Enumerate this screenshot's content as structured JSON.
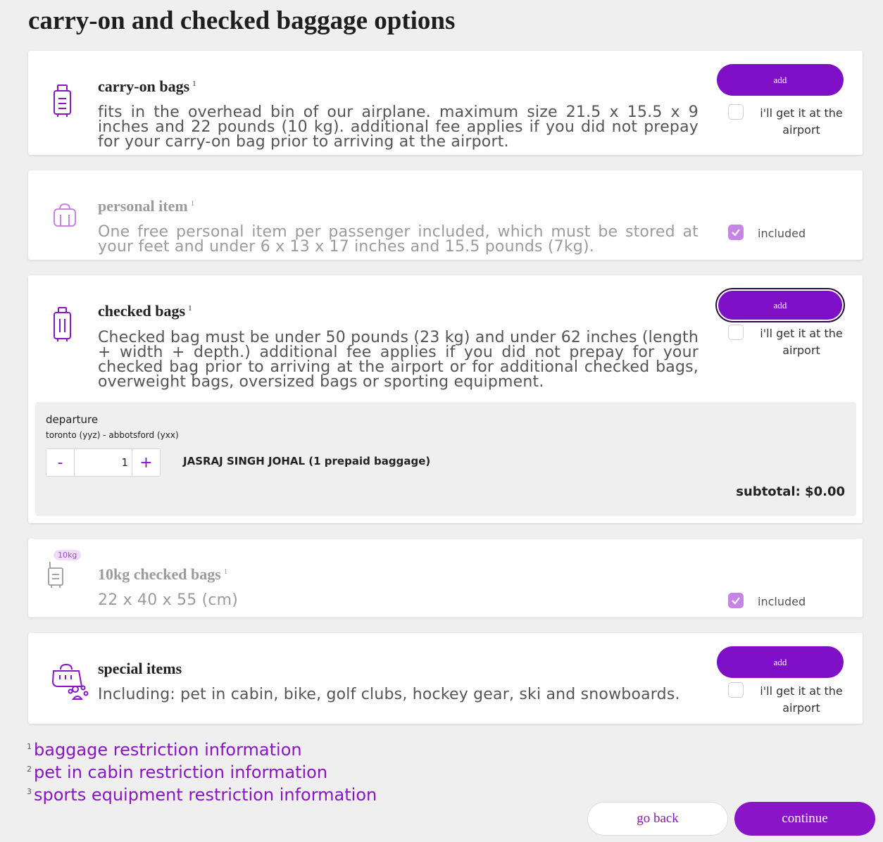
{
  "page": {
    "title": "carry-on and checked baggage options"
  },
  "carry_on": {
    "title": "carry-on bags",
    "sup": "1",
    "description": "fits in the overhead bin of our airplane. maximum size 21.5 x 15.5 x 9 inches and 22 pounds (10 kg). additional fee applies if you did not prepay for your carry-on bag prior to arriving at the airport.",
    "add_label": "add",
    "airport_label": "i'll get it at the airport",
    "airport_checked": false
  },
  "personal_item": {
    "title": "personal item",
    "sup": "1",
    "description": "One free personal item per passenger included, which must be stored at your feet and under 6 x 13 x 17 inches and 15.5 pounds (7kg).",
    "included_label": "included",
    "included_checked": true
  },
  "checked": {
    "title": "checked bags",
    "sup": "1",
    "description": "Checked bag must be under 50 pounds (23 kg) and under 62 inches (length + width + depth.) additional fee applies if you did not prepay for your checked bag prior to arriving at the airport or for additional checked bags, overweight bags, oversized bags or sporting equipment.",
    "add_label": "add",
    "airport_label": "i'll get it at the airport",
    "airport_checked": false,
    "departure": {
      "title": "departure",
      "route": "toronto (yyz) - abbotsford (yxx)",
      "minus_label": "-",
      "quantity": "1",
      "plus_label": "+",
      "passenger": "JASRAJ SINGH JOHAL (1 prepaid baggage)",
      "subtotal": "subtotal: $0.00"
    }
  },
  "checked_10kg": {
    "badge": "10kg",
    "title": "10kg checked bags",
    "sup": "1",
    "description": "22 x 40 x 55 (cm)",
    "included_label": "included",
    "included_checked": true
  },
  "special": {
    "title": "special items",
    "description": "Including: pet in cabin, bike, golf clubs, hockey gear, ski and snowboards.",
    "add_label": "add",
    "airport_label": "i'll get it at the airport",
    "airport_checked": false
  },
  "footnotes": [
    {
      "num": "1",
      "text": "baggage restriction information"
    },
    {
      "num": "2",
      "text": "pet in cabin restriction information"
    },
    {
      "num": "3",
      "text": "sports equipment restriction information"
    }
  ],
  "actions": {
    "back_label": "go back",
    "continue_label": "continue"
  },
  "colors": {
    "accent": "#8a14c8",
    "button": "#7f0fc7",
    "included_check": "#c584e6",
    "background": "#efefef"
  }
}
